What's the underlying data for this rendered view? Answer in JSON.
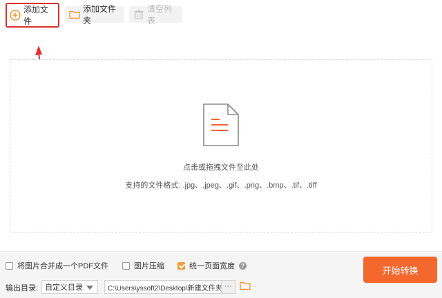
{
  "toolbar": {
    "add_file": "添加文件",
    "add_folder": "添加文件夹",
    "clear_list": "清空列表"
  },
  "dropzone": {
    "hint": "点击或拖拽文件至此处",
    "formats": "支持的文件格式: .jpg、.jpeg、.gif、.png、.bmp、.tif、.tiff"
  },
  "options": {
    "merge_pdf": {
      "label": "将图片合并成一个PDF文件",
      "checked": false
    },
    "compress": {
      "label": "图片压缩",
      "checked": false
    },
    "unify_width": {
      "label": "统一页面宽度",
      "checked": true
    }
  },
  "output": {
    "label": "输出目录:",
    "mode": "自定义目录",
    "path": "C:\\Users\\yssoft2\\Desktop\\新建文件夹\\",
    "browse": "···"
  },
  "start_button": "开始转换",
  "colors": {
    "accent": "#f4682d",
    "highlight_box": "#d9322b",
    "checkbox_on": "#f39c39"
  },
  "icons": {
    "add": "plus-circle-icon",
    "folder": "folder-icon",
    "clear": "clear-list-icon",
    "document": "document-icon",
    "help": "help-icon",
    "dropdown": "caret-down-icon"
  }
}
